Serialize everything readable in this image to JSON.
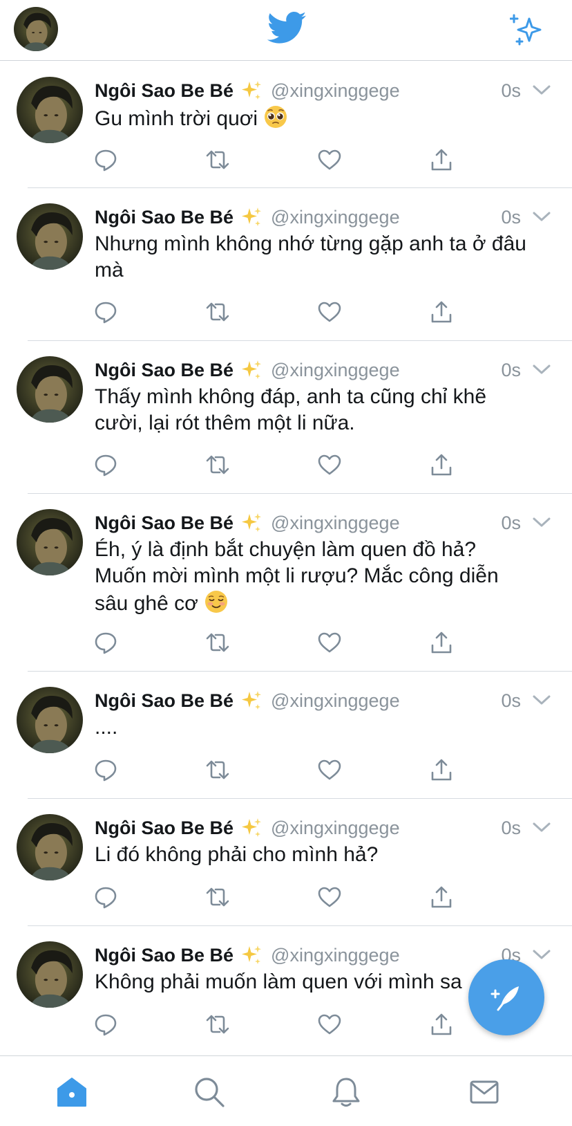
{
  "app": {
    "name": "Twitter",
    "brand_color": "#1da1f2",
    "accent_color": "#4a9fe8"
  },
  "header": {
    "logo_icon": "twitter-bird-icon",
    "right_icon": "sparkle-icon"
  },
  "author": {
    "name": "Ngôi Sao Be Bé",
    "name_emoji": "✨",
    "handle": "@xingxinggege",
    "time": "0s"
  },
  "tweets": [
    {
      "text": "Gu mình trời quơi",
      "emoji": "🥺"
    },
    {
      "text": "Nhưng mình không nhớ từng gặp anh ta ở đâu mà"
    },
    {
      "text": "Thấy mình không đáp, anh ta cũng chỉ khẽ cười, lại rót thêm một li nữa."
    },
    {
      "text": "Éh, ý là định bắt chuyện làm quen đồ hả? Muốn mời mình một li rượu? Mắc công diễn sâu ghê cơ",
      "emoji": "☺️"
    },
    {
      "text": "...."
    },
    {
      "text": "Li đó không phải cho mình hả?"
    },
    {
      "text": "Không phải muốn làm quen với mình sa"
    }
  ],
  "tabs": [
    {
      "icon": "home-icon",
      "active": true
    },
    {
      "icon": "search-icon",
      "active": false
    },
    {
      "icon": "notifications-icon",
      "active": false
    },
    {
      "icon": "messages-icon",
      "active": false
    }
  ],
  "fab": {
    "icon": "compose-tweet-icon"
  }
}
